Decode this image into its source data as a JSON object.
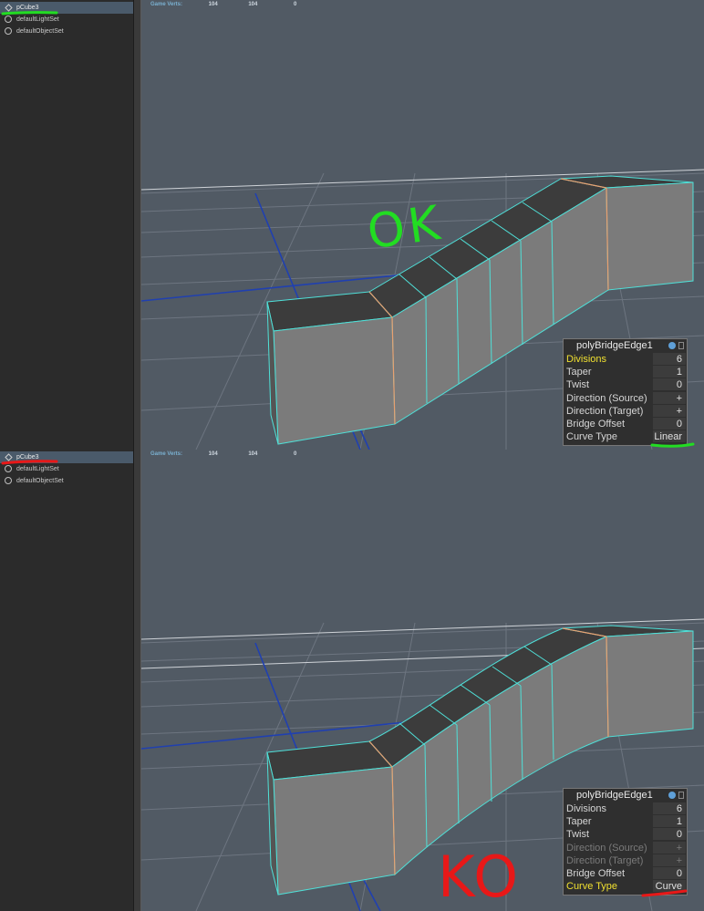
{
  "hud": {
    "label": "Game Verts:",
    "values": [
      "104",
      "104",
      "0"
    ]
  },
  "outliner": {
    "items": [
      {
        "label": "pCube3",
        "icon": "mesh-icon",
        "selected": true
      },
      {
        "label": "defaultLightSet",
        "icon": "set-icon",
        "selected": false
      },
      {
        "label": "defaultObjectSet",
        "icon": "set-icon",
        "selected": false
      }
    ]
  },
  "top_panel": {
    "title": "polyBridgeEdge1",
    "rows": [
      {
        "name": "Divisions",
        "value": "6",
        "highlight": true,
        "disabled": false
      },
      {
        "name": "Taper",
        "value": "1",
        "highlight": false,
        "disabled": false
      },
      {
        "name": "Twist",
        "value": "0",
        "highlight": false,
        "disabled": false
      },
      {
        "name": "Direction (Source)",
        "value": "+",
        "highlight": false,
        "disabled": false
      },
      {
        "name": "Direction (Target)",
        "value": "+",
        "highlight": false,
        "disabled": false
      },
      {
        "name": "Bridge Offset",
        "value": "0",
        "highlight": false,
        "disabled": false
      },
      {
        "name": "Curve Type",
        "value": "Linear",
        "highlight": false,
        "disabled": false
      }
    ]
  },
  "bottom_panel": {
    "title": "polyBridgeEdge1",
    "rows": [
      {
        "name": "Divisions",
        "value": "6",
        "highlight": false,
        "disabled": false
      },
      {
        "name": "Taper",
        "value": "1",
        "highlight": false,
        "disabled": false
      },
      {
        "name": "Twist",
        "value": "0",
        "highlight": false,
        "disabled": false
      },
      {
        "name": "Direction (Source)",
        "value": "+",
        "highlight": false,
        "disabled": true
      },
      {
        "name": "Direction (Target)",
        "value": "+",
        "highlight": false,
        "disabled": true
      },
      {
        "name": "Bridge Offset",
        "value": "0",
        "highlight": false,
        "disabled": false
      },
      {
        "name": "Curve Type",
        "value": "Curve",
        "highlight": true,
        "disabled": false
      }
    ]
  },
  "annotations": {
    "top_text": "OK",
    "bottom_text": "KO",
    "ok_color": "#22dd22",
    "ko_color": "#e81818"
  },
  "colors": {
    "wire": "#4fe0d8",
    "seam": "#e8a070",
    "face_top": "#3c3c3c",
    "face_side": "#7b7b7b",
    "grid": "#6d7580",
    "axis": "#2040b0"
  }
}
